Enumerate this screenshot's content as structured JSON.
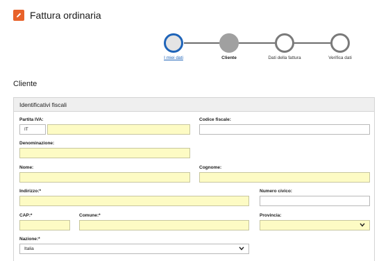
{
  "header": {
    "title": "Fattura ordinaria",
    "icon": "pencil-icon"
  },
  "stepper": {
    "steps": [
      {
        "label": "I miei dati",
        "state": "active"
      },
      {
        "label": "Cliente",
        "state": "current"
      },
      {
        "label": "Dati della fattura",
        "state": "todo"
      },
      {
        "label": "Verifica dati",
        "state": "todo"
      }
    ]
  },
  "section": {
    "title": "Cliente"
  },
  "panel": {
    "title": "Identificativi fiscali",
    "fields": {
      "partita_iva": {
        "label": "Partita IVA:",
        "country": "IT",
        "value": ""
      },
      "codice_fiscale": {
        "label": "Codice fiscale:",
        "value": ""
      },
      "denominazione": {
        "label": "Denominazione:",
        "value": ""
      },
      "nome": {
        "label": "Nome:",
        "value": ""
      },
      "cognome": {
        "label": "Cognome:",
        "value": ""
      },
      "indirizzo": {
        "label": "Indirizzo:*",
        "value": ""
      },
      "numero_civico": {
        "label": "Numero civico:",
        "value": ""
      },
      "cap": {
        "label": "CAP:*",
        "value": ""
      },
      "comune": {
        "label": "Comune:*",
        "value": ""
      },
      "provincia": {
        "label": "Provincia:",
        "value": ""
      },
      "nazione": {
        "label": "Nazione:*",
        "value": "Italia"
      }
    }
  },
  "colors": {
    "accent": "#e8622a",
    "link": "#1f64b8",
    "required_bg": "#fdfbc4"
  }
}
